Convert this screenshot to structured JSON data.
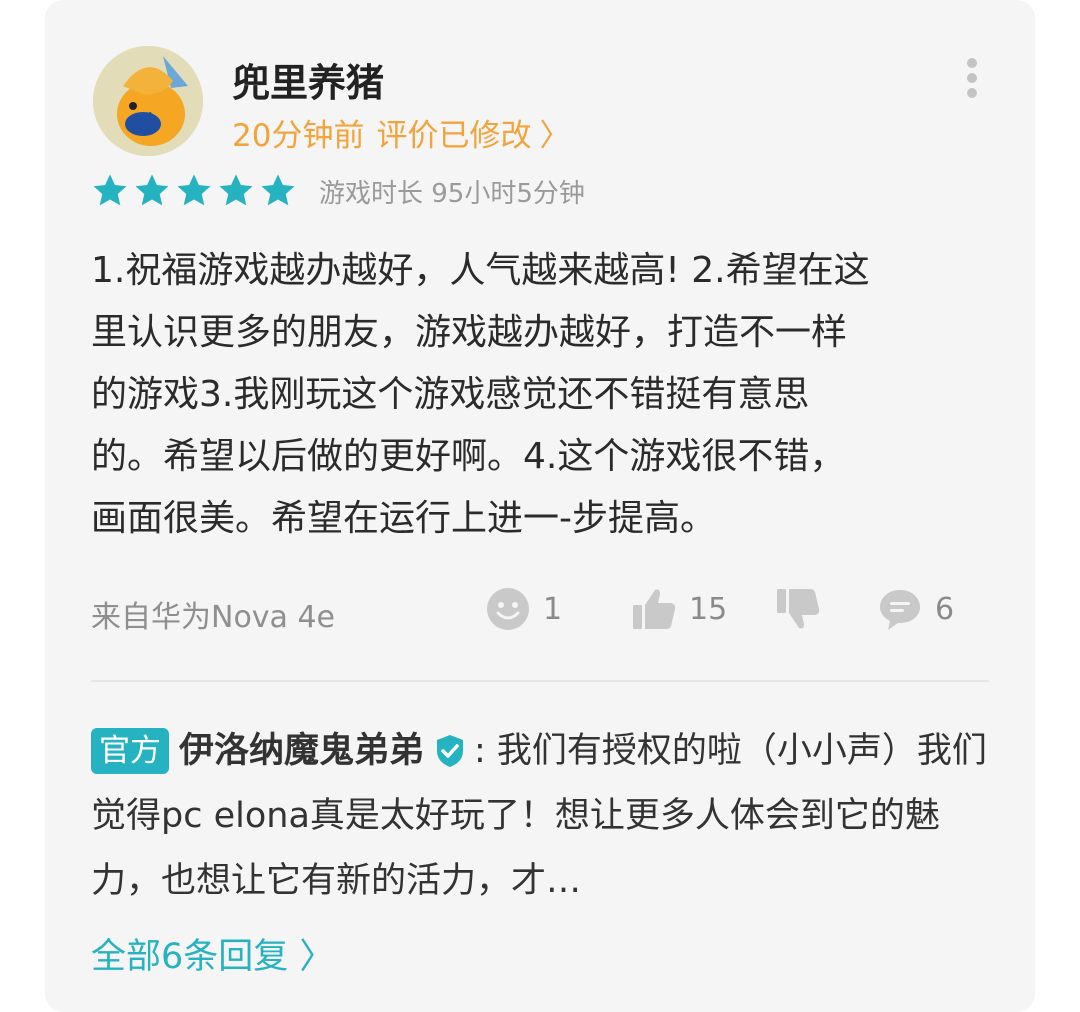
{
  "review": {
    "username": "兜里养猪",
    "time_ago": "20分钟前",
    "edited_label": "评价已修改",
    "chevron": "〉",
    "rating": 5,
    "star_color": "#25b2c1",
    "playtime": "游戏时长 95小时5分钟",
    "body": "1.祝福游戏越办越好，人气越来越高! 2.希望在这\n里认识更多的朋友，游戏越办越好，打造不一样\n的游戏3.我刚玩这个游戏感觉还不错挺有意思\n的。希望以后做的更好啊。4.这个游戏很不错，\n画面很美。希望在运行上进一-步提高。",
    "device": "来自华为Nova 4e",
    "emoji_count": "1",
    "like_count": "15",
    "comment_count": "6",
    "accent_color": "#f2a43a"
  },
  "reply": {
    "badge": "官方",
    "name": "伊洛纳魔鬼弟弟",
    "text": ": 我们有授权的啦（小小声）我们觉得pc elona真是太好玩了！想让更多人体会到它的魅力，也想让它有新的活力，才…",
    "all_replies": "全部6条回复",
    "chevron": "〉",
    "badge_color": "#25b2c1"
  },
  "icons": {
    "more": "more-vert-icon",
    "star": "star-icon",
    "emoji": "emoji-icon",
    "like": "thumbs-up-icon",
    "dislike": "thumbs-down-icon",
    "comment": "comment-icon",
    "verified": "verified-icon"
  }
}
